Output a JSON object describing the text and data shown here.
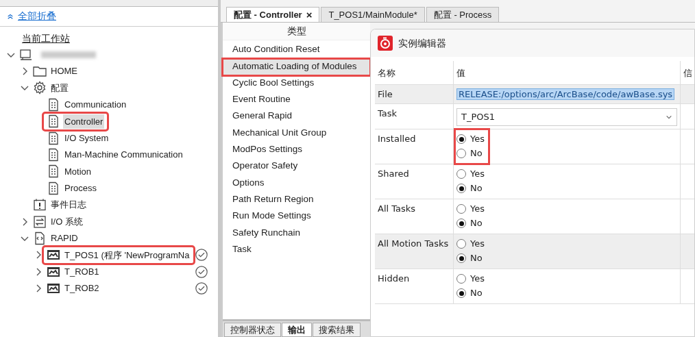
{
  "collapse_all": {
    "label": "全部折叠"
  },
  "station_header": "当前工作站",
  "tree": [
    {
      "kind": "station",
      "expanded": true,
      "children": [
        {
          "label": "HOME",
          "kind": "folder",
          "expanded": false,
          "selected": false
        },
        {
          "label": "配置",
          "kind": "gear",
          "expanded": true,
          "selected": false,
          "children": [
            {
              "label": "Communication",
              "kind": "doc",
              "selected": false
            },
            {
              "label": "Controller",
              "kind": "doc",
              "selected": true,
              "highlighted": true
            },
            {
              "label": "I/O System",
              "kind": "doc",
              "selected": false
            },
            {
              "label": "Man-Machine Communication",
              "kind": "doc",
              "selected": false
            },
            {
              "label": "Motion",
              "kind": "doc",
              "selected": false
            },
            {
              "label": "Process",
              "kind": "doc",
              "selected": false
            }
          ]
        },
        {
          "label": "事件日志",
          "kind": "event",
          "selected": false
        },
        {
          "label": "I/O 系统",
          "kind": "io",
          "expanded": false,
          "selected": false
        },
        {
          "label": "RAPID",
          "kind": "rapid",
          "expanded": true,
          "selected": false,
          "children": [
            {
              "label": "T_POS1 (程序 'NewProgramNa",
              "kind": "task",
              "expanded": false,
              "selected": false,
              "checked": true,
              "highlighted": true
            },
            {
              "label": "T_ROB1",
              "kind": "task",
              "expanded": false,
              "selected": false,
              "checked": true
            },
            {
              "label": "T_ROB2",
              "kind": "task",
              "expanded": false,
              "selected": false,
              "checked": true
            }
          ]
        }
      ]
    }
  ],
  "tabs": [
    {
      "label": "配置 - Controller",
      "selected": true,
      "close": "×"
    },
    {
      "label": "T_POS1/MainModule*",
      "selected": false
    },
    {
      "label": "配置 - Process",
      "selected": false
    }
  ],
  "types": {
    "header": "类型",
    "items": [
      {
        "label": "Auto Condition Reset",
        "selected": false
      },
      {
        "label": "Automatic Loading of Modules",
        "selected": true,
        "highlighted": true
      },
      {
        "label": "Cyclic Bool Settings",
        "selected": false
      },
      {
        "label": "Event Routine",
        "selected": false
      },
      {
        "label": "General Rapid",
        "selected": false
      },
      {
        "label": "Mechanical Unit Group",
        "selected": false
      },
      {
        "label": "ModPos Settings",
        "selected": false
      },
      {
        "label": "Operator Safety",
        "selected": false
      },
      {
        "label": "Options",
        "selected": false
      },
      {
        "label": "Path Return Region",
        "selected": false
      },
      {
        "label": "Run Mode Settings",
        "selected": false
      },
      {
        "label": "Safety Runchain",
        "selected": false
      },
      {
        "label": "Task",
        "selected": false
      }
    ]
  },
  "bottom_tabs": [
    {
      "label": "控制器状态",
      "selected": false
    },
    {
      "label": "输出",
      "selected": true
    },
    {
      "label": "搜索结果",
      "selected": false
    }
  ],
  "editor": {
    "title": "实例编辑器",
    "columns": [
      "名称",
      "值",
      "信"
    ],
    "rows": [
      {
        "name": "File",
        "kind": "text",
        "value": "RELEASE:/options/arc/ArcBase/code/awBase.sys",
        "selected": true
      },
      {
        "name": "Task",
        "kind": "select",
        "value": "T_POS1",
        "selected": false
      },
      {
        "name": "Installed",
        "kind": "radio",
        "selected": false,
        "highlighted": true,
        "options": [
          {
            "label": "Yes",
            "selected": true
          },
          {
            "label": "No",
            "selected": false
          }
        ]
      },
      {
        "name": "Shared",
        "kind": "radio",
        "selected": false,
        "options": [
          {
            "label": "Yes",
            "selected": false
          },
          {
            "label": "No",
            "selected": true
          }
        ]
      },
      {
        "name": "All Tasks",
        "kind": "radio",
        "selected": false,
        "options": [
          {
            "label": "Yes",
            "selected": false
          },
          {
            "label": "No",
            "selected": true
          }
        ]
      },
      {
        "name": "All Motion Tasks",
        "kind": "radio",
        "selected": true,
        "options": [
          {
            "label": "Yes",
            "selected": false
          },
          {
            "label": "No",
            "selected": true
          }
        ]
      },
      {
        "name": "Hidden",
        "kind": "radio",
        "selected": false,
        "options": [
          {
            "label": "Yes",
            "selected": false
          },
          {
            "label": "No",
            "selected": true
          }
        ]
      }
    ]
  }
}
